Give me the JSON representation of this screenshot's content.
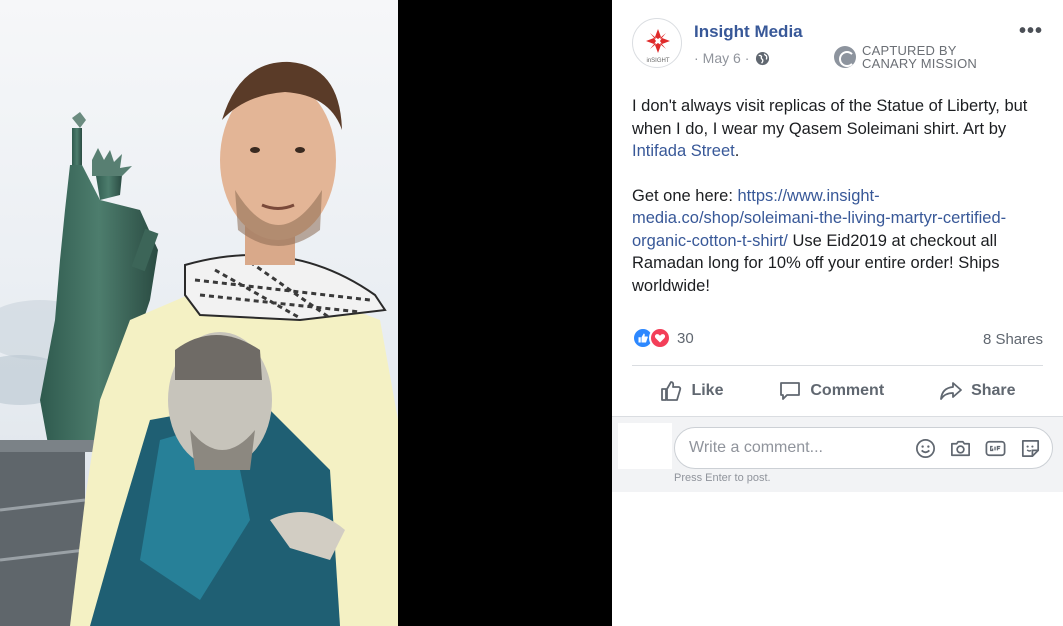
{
  "post": {
    "page_name": "Insight Media",
    "avatar_text": "inSIGHT",
    "date": "May 6",
    "date_separator": "·",
    "privacy_icon": "globe-icon",
    "more_label": "•••",
    "watermark": {
      "line1": "CAPTURED BY",
      "line2": "CANARY MISSION"
    },
    "paragraph1": {
      "text_before": "I don't always visit replicas of the Statue of Liberty, but when I do, I wear my Qasem Soleimani shirt. Art by ",
      "link": "Intifada Street",
      "text_after": "."
    },
    "paragraph2": {
      "text_before": "Get one here: ",
      "link": "https://www.insight-media.co/shop/soleimani-the-living-martyr-certified-organic-cotton-t-shirt/",
      "text_after": " Use Eid2019 at checkout all Ramadan long for 10% off your entire order! Ships worldwide!"
    },
    "reaction_count": "30",
    "shares": "8 Shares"
  },
  "actions": {
    "like": "Like",
    "comment": "Comment",
    "share": "Share"
  },
  "comment": {
    "placeholder": "Write a comment...",
    "hint": "Press Enter to post.",
    "icons": [
      "emoji-icon",
      "camera-icon",
      "gif-icon",
      "sticker-icon"
    ]
  },
  "colors": {
    "link": "#385898",
    "like_blue": "#2d88ff",
    "love_red": "#f33e58",
    "text": "#1c1e21",
    "muted": "#90949c"
  }
}
